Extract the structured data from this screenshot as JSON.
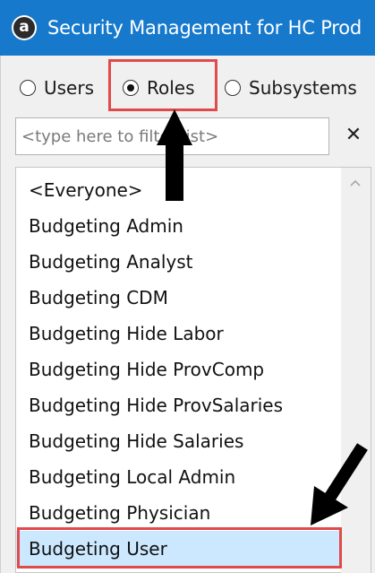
{
  "window": {
    "title": "Security Management for HC Prod",
    "app_icon_letter": "a"
  },
  "mode_options": [
    {
      "label": "Users",
      "checked": false
    },
    {
      "label": "Roles",
      "checked": true
    },
    {
      "label": "Subsystems",
      "checked": false
    }
  ],
  "filter": {
    "placeholder": "<type here to filter list>",
    "value": "",
    "clear_label": "✕"
  },
  "roles_list": {
    "items": [
      "<Everyone>",
      "Budgeting Admin",
      "Budgeting Analyst",
      "Budgeting CDM",
      "Budgeting Hide Labor",
      "Budgeting Hide ProvComp",
      "Budgeting Hide ProvSalaries",
      "Budgeting Hide Salaries",
      "Budgeting Local Admin",
      "Budgeting Physician",
      "Budgeting User"
    ],
    "selected_index": 10
  },
  "colors": {
    "titlebar": "#1679cc",
    "selection": "#cce8ff",
    "annotation": "#e04a4a"
  }
}
